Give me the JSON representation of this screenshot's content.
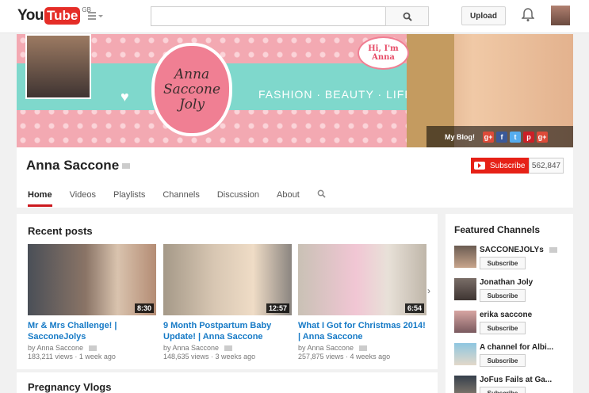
{
  "header": {
    "logo_you": "You",
    "logo_tube": "Tube",
    "logo_region": "GB",
    "search_placeholder": "",
    "upload_label": "Upload"
  },
  "channel": {
    "banner_name": "Anna Saccone Joly",
    "banner_tagline": "FASHION · BEAUTY · LIFESTYLE",
    "speech_bubble": "Hi, I'm Anna",
    "blog_link": "My Blog!",
    "name": "Anna Saccone",
    "subscribe_label": "Subscribe",
    "subscriber_count": "562,847",
    "tabs": [
      {
        "label": "Home"
      },
      {
        "label": "Videos"
      },
      {
        "label": "Playlists"
      },
      {
        "label": "Channels"
      },
      {
        "label": "Discussion"
      },
      {
        "label": "About"
      }
    ]
  },
  "recent": {
    "heading": "Recent posts",
    "videos": [
      {
        "title": "Mr & Mrs Challenge! | SacconeJolys",
        "by": "by Anna Saccone",
        "views": "183,211 views",
        "age": "1 week ago",
        "duration": "8:30"
      },
      {
        "title": "9 Month Postpartum Baby Update! | Anna Saccone",
        "by": "by Anna Saccone",
        "views": "148,635 views",
        "age": "3 weeks ago",
        "duration": "12:57"
      },
      {
        "title": "What I Got for Christmas 2014! | Anna Saccone",
        "by": "by Anna Saccone",
        "views": "257,875 views",
        "age": "4 weeks ago",
        "duration": "6:54"
      }
    ]
  },
  "next_section": "Pregnancy Vlogs",
  "featured": {
    "heading": "Featured Channels",
    "subscribe_label": "Subscribe",
    "channels": [
      {
        "name": "SACCONEJOLYs"
      },
      {
        "name": "Jonathan Joly"
      },
      {
        "name": "erika saccone"
      },
      {
        "name": "A channel for Albi..."
      },
      {
        "name": "JoFus Fails at Ga..."
      }
    ]
  },
  "colors": {
    "youtube_red": "#e52d27",
    "link_blue": "#167ac6",
    "banner_pink": "#f3a9b2",
    "banner_mint": "#7fd8cc"
  }
}
